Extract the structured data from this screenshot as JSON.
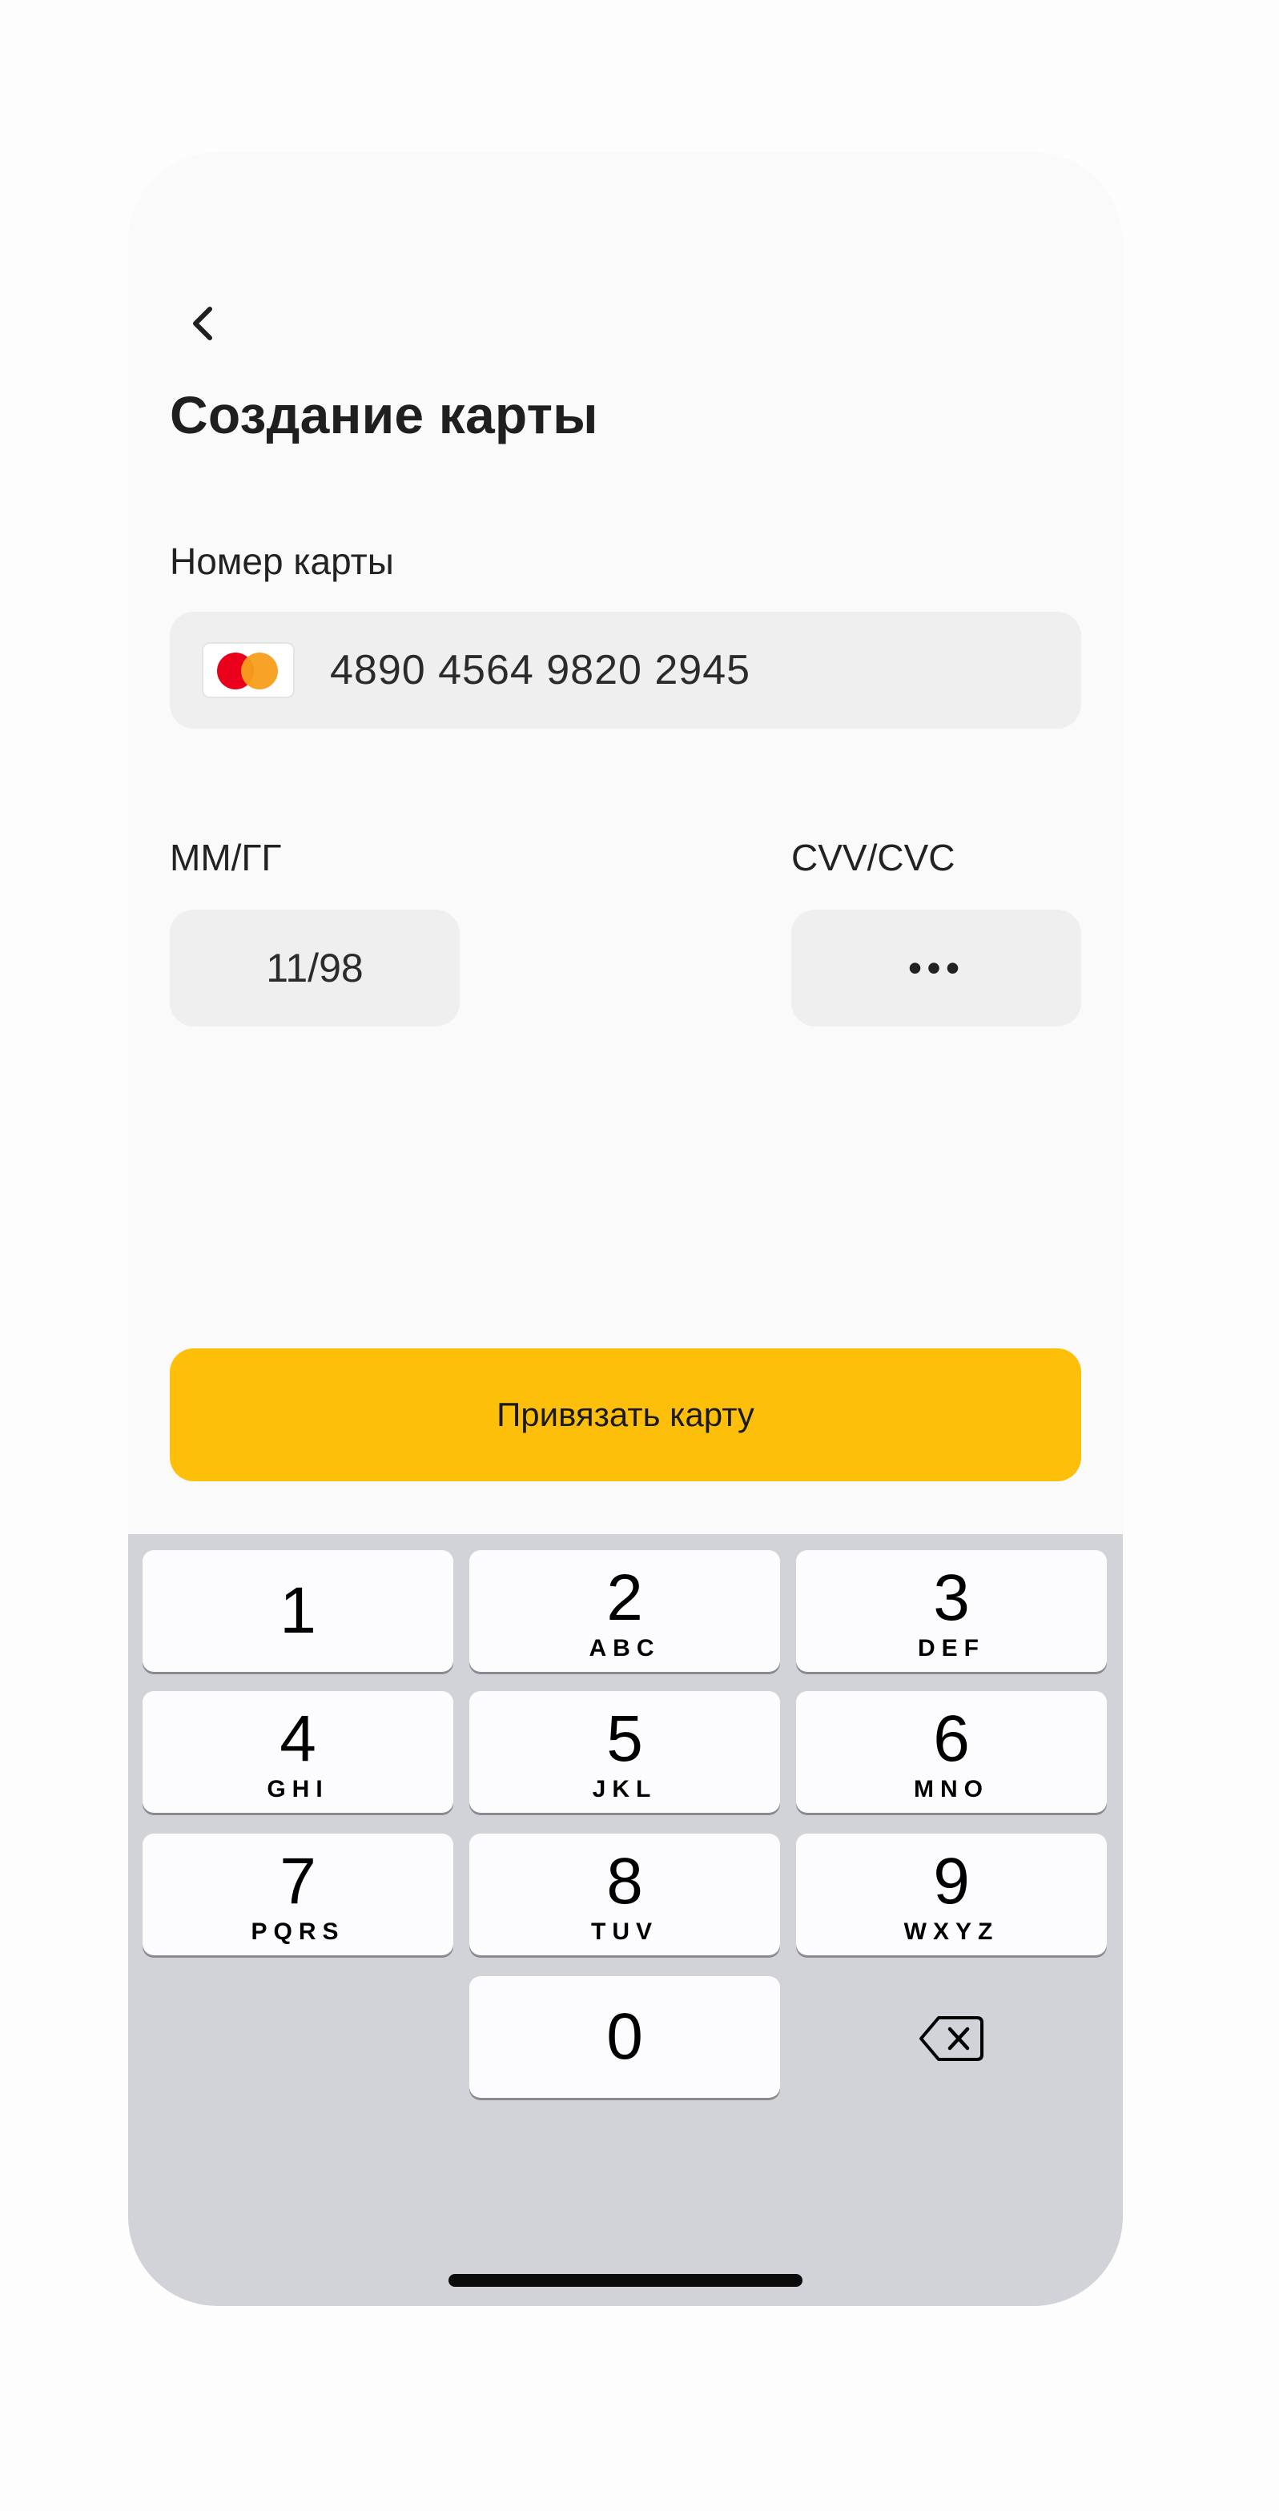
{
  "header": {
    "back_icon": "chevron-left-icon",
    "title": "Создание карты"
  },
  "card_number": {
    "label": "Номер карты",
    "value": "4890 4564 9820 2945",
    "brand_icon": "mastercard-icon",
    "brand_colors": [
      "#eb001b",
      "#f79e1b"
    ]
  },
  "expiry": {
    "label": "ММ/ГГ",
    "value": "11/98"
  },
  "cvv": {
    "label": "CVV/CVC",
    "value": "•••"
  },
  "submit": {
    "label": "Привязать карту",
    "color": "#fdbf0a"
  },
  "keypad": {
    "keys": [
      {
        "digit": "1",
        "letters": ""
      },
      {
        "digit": "2",
        "letters": "ABC"
      },
      {
        "digit": "3",
        "letters": "DEF"
      },
      {
        "digit": "4",
        "letters": "GHI"
      },
      {
        "digit": "5",
        "letters": "JKL"
      },
      {
        "digit": "6",
        "letters": "MNO"
      },
      {
        "digit": "7",
        "letters": "PQRS"
      },
      {
        "digit": "8",
        "letters": "TUV"
      },
      {
        "digit": "9",
        "letters": "WXYZ"
      },
      {
        "digit": "0",
        "letters": ""
      }
    ],
    "backspace_icon": "backspace-icon"
  }
}
